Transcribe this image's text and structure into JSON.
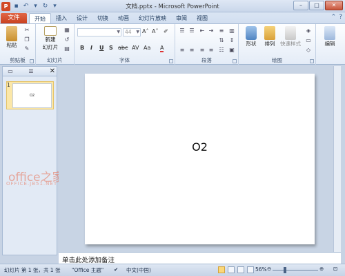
{
  "window": {
    "title": "文档.pptx - Microsoft PowerPoint"
  },
  "tabs": {
    "file": "文件",
    "items": [
      "开始",
      "插入",
      "设计",
      "切换",
      "动画",
      "幻灯片放映",
      "审阅",
      "视图"
    ]
  },
  "ribbon": {
    "clipboard": {
      "paste": "粘贴",
      "label": "剪贴板"
    },
    "slides": {
      "new_slide_line1": "新建",
      "new_slide_line2": "幻灯片",
      "label": "幻灯片"
    },
    "font": {
      "size": "44",
      "label": "字体"
    },
    "paragraph": {
      "label": "段落"
    },
    "drawing": {
      "shapes": "形状",
      "arrange": "排列",
      "quick_styles": "快速样式",
      "label": "绘图"
    },
    "editing": {
      "edit": "编辑"
    }
  },
  "thumbnail": {
    "number": "1",
    "text": "O2"
  },
  "slide": {
    "text": "O2"
  },
  "notes": {
    "placeholder": "单击此处添加备注"
  },
  "watermark": {
    "line1": "office之家",
    "line2": "OFFICE.JB51.NET"
  },
  "status": {
    "slide_info": "幻灯片 第 1 张，共 1 张",
    "theme": "\"Office 主题\"",
    "language": "中文(中国)",
    "zoom": "56%"
  }
}
